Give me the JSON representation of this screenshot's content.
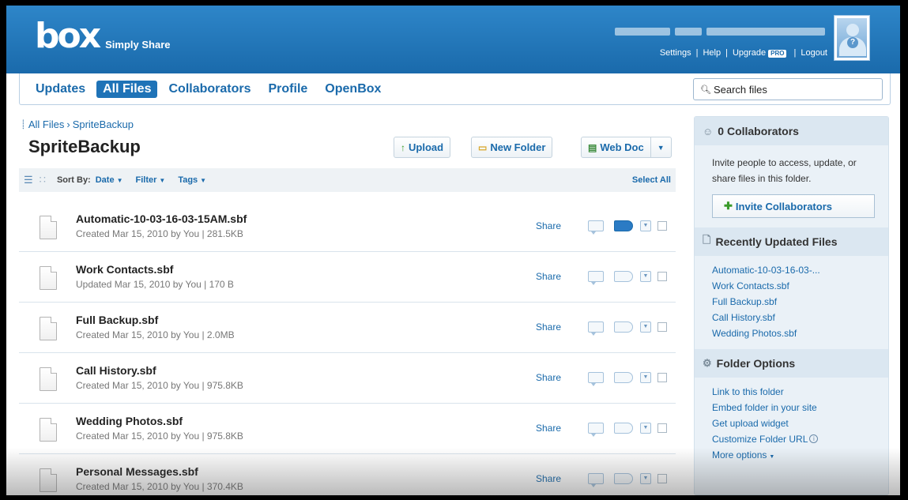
{
  "header": {
    "logo": "box",
    "tagline": "Simply Share",
    "links": {
      "settings": "Settings",
      "help": "Help",
      "upgrade": "Upgrade",
      "pro_badge": "PRO",
      "logout": "Logout",
      "separator": "|"
    },
    "avatar_icon": "user-question-icon"
  },
  "nav": {
    "tabs": [
      {
        "label": "Updates",
        "active": false
      },
      {
        "label": "All Files",
        "active": true
      },
      {
        "label": "Collaborators",
        "active": false
      },
      {
        "label": "Profile",
        "active": false
      },
      {
        "label": "OpenBox",
        "active": false
      }
    ],
    "search_placeholder": "Search files"
  },
  "main": {
    "breadcrumb": {
      "root": "All Files",
      "sep": "›",
      "current": "SpriteBackup"
    },
    "title": "SpriteBackup",
    "toolbar": {
      "upload": "Upload",
      "new_folder": "New Folder",
      "web_doc": "Web Doc"
    },
    "sortbar": {
      "sort_by": "Sort By:",
      "date": "Date",
      "filter": "Filter",
      "tags": "Tags",
      "select_all": "Select All"
    },
    "share_label": "Share",
    "files": [
      {
        "name": "Automatic-10-03-16-03-15AM.sbf",
        "meta": "Created Mar 15, 2010 by You  |  281.5KB",
        "tagged": true
      },
      {
        "name": "Work Contacts.sbf",
        "meta": "Updated Mar 15, 2010 by You  |  170 B",
        "tagged": false
      },
      {
        "name": "Full Backup.sbf",
        "meta": "Created Mar 15, 2010 by You  |  2.0MB",
        "tagged": false
      },
      {
        "name": "Call History.sbf",
        "meta": "Created Mar 15, 2010 by You  |  975.8KB",
        "tagged": false
      },
      {
        "name": "Wedding Photos.sbf",
        "meta": "Created Mar 15, 2010 by You  |  975.8KB",
        "tagged": false
      },
      {
        "name": "Personal Messages.sbf",
        "meta": "Created Mar 15, 2010 by You  |  370.4KB",
        "tagged": false
      }
    ]
  },
  "sidebar": {
    "collaborators": {
      "title": "0 Collaborators",
      "text": "Invite people to access, update, or share files in this folder.",
      "button": "Invite Collaborators"
    },
    "recent": {
      "title": "Recently Updated Files",
      "items": [
        "Automatic-10-03-16-03-...",
        "Work Contacts.sbf",
        "Full Backup.sbf",
        "Call History.sbf",
        "Wedding Photos.sbf"
      ]
    },
    "folder_options": {
      "title": "Folder Options",
      "items": [
        "Link to this folder",
        "Embed folder in your site",
        "Get upload widget",
        "Customize Folder URL",
        "More options"
      ]
    }
  }
}
